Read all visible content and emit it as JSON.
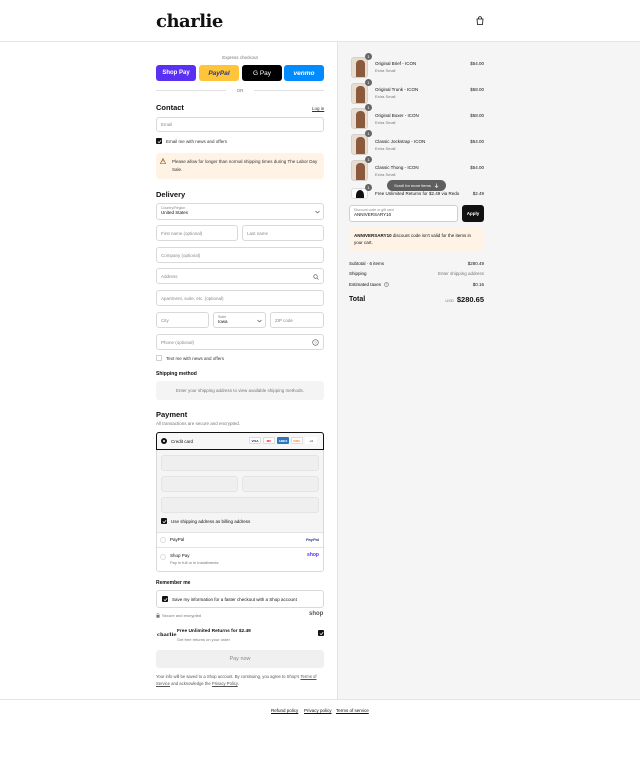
{
  "header": {
    "logo": "charlie",
    "cart_icon": "shopping-bag-icon"
  },
  "express": {
    "title": "Express checkout",
    "buttons": [
      "Shop Pay",
      "PayPal",
      "G Pay",
      "venmo"
    ],
    "or": "OR"
  },
  "contact": {
    "title": "Contact",
    "login": "Log in",
    "email_placeholder": "Email",
    "email_news": "Email me with news and offers",
    "notice": "Please allow for longer than normal shipping times during The Labor Day Sale."
  },
  "delivery": {
    "title": "Delivery",
    "country_label": "Country/Region",
    "country_value": "United States",
    "first_name": "First name (optional)",
    "last_name": "Last name",
    "company": "Company (optional)",
    "address": "Address",
    "apartment": "Apartment, suite, etc. (optional)",
    "city": "City",
    "state_label": "State",
    "state_value": "Iowa",
    "zip": "ZIP code",
    "phone": "Phone (optional)",
    "text_news": "Text me with news and offers"
  },
  "shipping": {
    "title": "Shipping method",
    "message": "Enter your shipping address to view available shipping methods."
  },
  "payment": {
    "title": "Payment",
    "subtitle": "All transactions are secure and encrypted.",
    "credit_card": "Credit card",
    "card_icons": [
      "VISA",
      "MC",
      "AMEX",
      "DISC",
      "+4"
    ],
    "billing_same": "Use shipping address as billing address",
    "paypal": "PayPal",
    "paypal_logo": "PayPal",
    "shop_pay": "Shop Pay",
    "shop_pay_sub": "Pay in full or in installments",
    "shop_logo": "shop"
  },
  "remember": {
    "title": "Remember me",
    "save_info": "Save my information for a faster checkout with a Shop account",
    "secure": "Secure and encrypted",
    "shop_logo": "shop"
  },
  "returns": {
    "logo": "charlie",
    "title": "Free Unlimited Returns for $2.49",
    "subtitle": "Get free returns on your order"
  },
  "pay_now": "Pay now",
  "legal": {
    "text1": "Your info will be saved to a Shop account. By continuing, you agree to Shop's",
    "terms": "Terms of Service",
    "and": "and acknowledge the",
    "privacy": "Privacy Policy",
    "dot": "."
  },
  "cart": {
    "items": [
      {
        "qty": "1",
        "name": "Original Brief - ICON",
        "variant": "Extra Small",
        "price": "$54.00"
      },
      {
        "qty": "1",
        "name": "Original Trunk - ICON",
        "variant": "Extra Small",
        "price": "$58.00"
      },
      {
        "qty": "1",
        "name": "Original Boxer - ICON",
        "variant": "Extra Small",
        "price": "$58.00"
      },
      {
        "qty": "1",
        "name": "Classic Jockstrap - ICON",
        "variant": "Extra Small",
        "price": "$54.00"
      },
      {
        "qty": "1",
        "name": "Classic Thong - ICON",
        "variant": "Extra Small",
        "price": "$54.00"
      },
      {
        "qty": "1",
        "name": "Free Unlimited Returns for $2.49 via Redo",
        "variant": "",
        "price": "$2.49"
      }
    ],
    "scroll_hint": "Scroll for more items",
    "discount_label": "Discount code or gift card",
    "discount_value": "ANNIVERSARY10",
    "apply": "Apply",
    "discount_error_code": "ANNIVERSARY10",
    "discount_error_text": "discount code isn't valid for the items in your cart.",
    "subtotal_label": "Subtotal · 6 items",
    "subtotal_value": "$280.49",
    "shipping_label": "Shipping",
    "shipping_value": "Enter shipping address",
    "taxes_label": "Estimated taxes",
    "taxes_value": "$0.16",
    "total_label": "Total",
    "currency": "USD",
    "total_value": "$280.65"
  },
  "footer": {
    "links": [
      "Refund policy",
      "Privacy policy",
      "Terms of service"
    ]
  }
}
